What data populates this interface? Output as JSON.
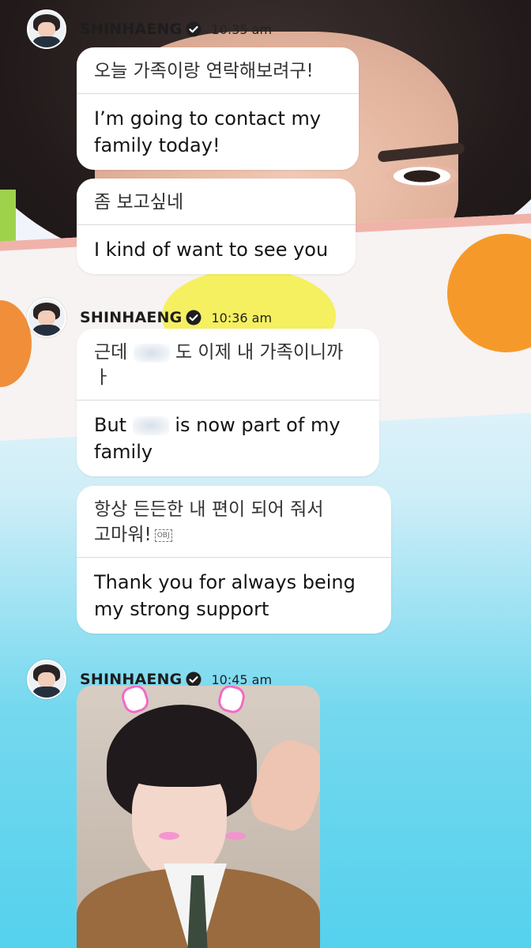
{
  "posts": [
    {
      "author": "SHINHAENG",
      "time": "10:35 am",
      "messages": [
        {
          "korean": "오늘 가족이랑 연락해보려구!",
          "english_line1": "I’m going to contact my",
          "english_line2": "family today!"
        },
        {
          "korean": "좀 보고싶네",
          "english": "I kind of want to see you"
        }
      ]
    },
    {
      "author": "SHINHAENG",
      "time": "10:36 am",
      "messages": [
        {
          "korean_pre": "근데",
          "korean_post": "도 이제 내 가족이니까",
          "korean_line2": "ㅏ",
          "english_pre": "But",
          "english_post": "is now part of my",
          "english_line2": "family"
        },
        {
          "korean_line1": "항상 든든한 내 편이 되어 줘서",
          "korean_line2": "고마워!",
          "obj_tag": "OBJ",
          "english_line1": "Thank you for always being",
          "english_line2": "my strong support"
        }
      ]
    },
    {
      "author": "SHINHAENG",
      "time": "10:45 am",
      "photo": "selfie-photo"
    }
  ],
  "icons": {
    "verified": "verified-badge-icon",
    "avatar": "profile-avatar"
  },
  "colors": {
    "bubble": "#ffffff",
    "text": "#141414",
    "separator": "#dadada"
  }
}
